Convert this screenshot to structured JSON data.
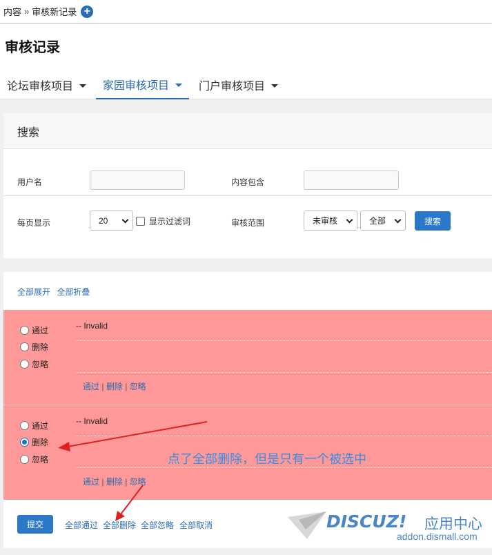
{
  "breadcrumb": {
    "root": "内容",
    "separator": "»",
    "current": "审核新记录"
  },
  "page_title": "审核记录",
  "tabs": [
    {
      "label": "论坛审核项目",
      "active": false
    },
    {
      "label": "家园审核项目",
      "active": true
    },
    {
      "label": "门户审核项目",
      "active": false
    }
  ],
  "search": {
    "heading": "搜索",
    "username_label": "用户名",
    "username_value": "",
    "content_label": "内容包含",
    "content_value": "",
    "per_page_label": "每页显示",
    "per_page_value": "20",
    "show_filtered_label": "显示过滤词",
    "scope_label": "审核范围",
    "scope_value": "未审核",
    "type_value": "全部",
    "search_button": "搜索"
  },
  "list": {
    "expand_all": "全部展开",
    "collapse_all": "全部折叠",
    "radio_options": [
      "通过",
      "删除",
      "忽略"
    ],
    "records": [
      {
        "text": "-- Invalid",
        "selected": null,
        "actions": [
          "通过",
          "删除",
          "忽略"
        ]
      },
      {
        "text": "-- Invalid",
        "selected": "删除",
        "actions": [
          "通过",
          "删除",
          "忽略"
        ]
      }
    ],
    "link_separator": "|"
  },
  "annotation": "点了全部删除，但是只有一个被选中",
  "bottom": {
    "submit": "提交",
    "pass_all": "全部通过",
    "delete_all": "全部删除",
    "ignore_all": "全部忽略",
    "cancel_all": "全部取消"
  },
  "watermark": {
    "brand": "DISCUZ!",
    "suffix": "应用中心",
    "domain": "addon.dismall.com"
  },
  "colors": {
    "accent": "#2b6cb0",
    "record_bg": "#ff9999",
    "annotation": "#3a8de0",
    "arrow": "#e02020"
  }
}
